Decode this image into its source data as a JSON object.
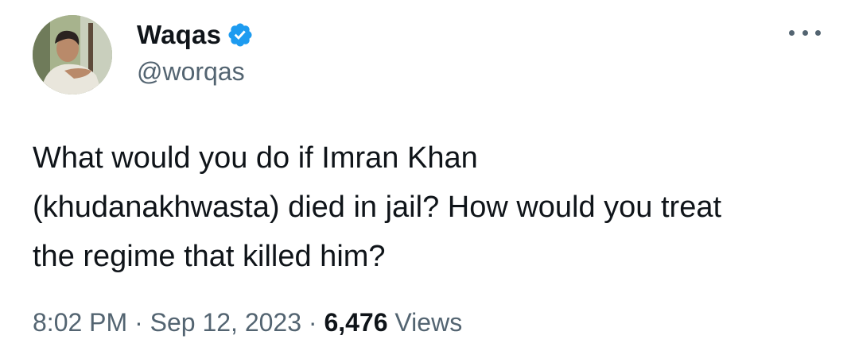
{
  "author": {
    "display_name": "Waqas",
    "handle": "@worqas",
    "verified": true,
    "verified_color": "#1d9bf0"
  },
  "icons": {
    "more": "more-horizontal-icon",
    "verified": "verified-badge-icon"
  },
  "tweet": {
    "lines": [
      "What would you do if Imran Khan",
      "(khudanakhwasta) died in jail? How would you treat",
      "the regime that killed him?"
    ]
  },
  "meta": {
    "time": "8:02 PM",
    "separator": "·",
    "date": "Sep 12, 2023",
    "views_count": "6,476",
    "views_label": "Views"
  }
}
